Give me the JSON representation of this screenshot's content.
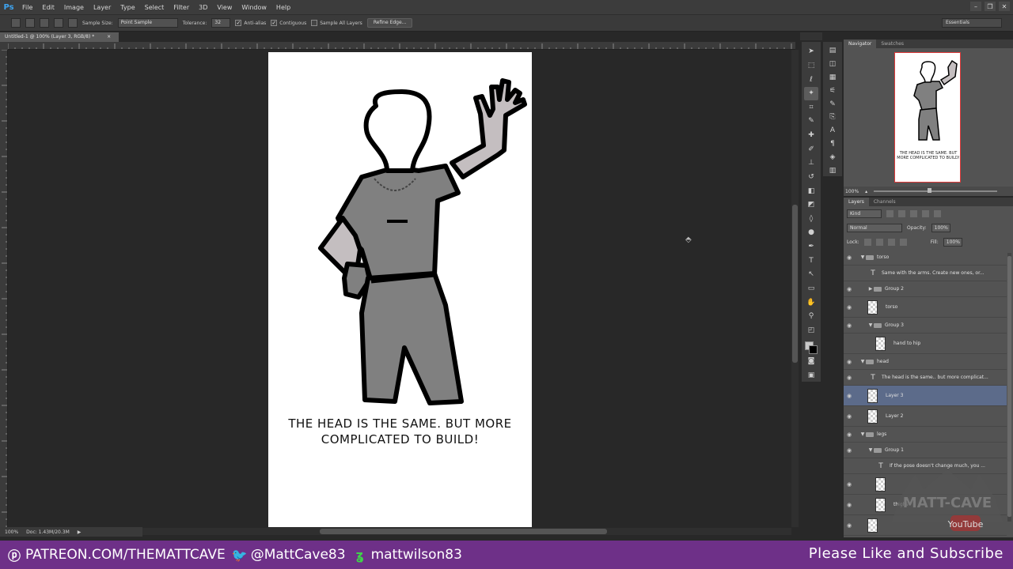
{
  "app": {
    "logo": "Ps",
    "menu": [
      "File",
      "Edit",
      "Image",
      "Layer",
      "Type",
      "Select",
      "Filter",
      "3D",
      "View",
      "Window",
      "Help"
    ],
    "window_controls": [
      "–",
      "❐",
      "✕"
    ]
  },
  "options_bar": {
    "sample_size_label": "Sample Size:",
    "sample_size_value": "Point Sample",
    "tolerance_label": "Tolerance:",
    "tolerance_value": "32",
    "antialias_label": "Anti-alias",
    "contiguous_label": "Contiguous",
    "sample_all_label": "Sample All Layers",
    "refine_edge_label": "Refine Edge...",
    "workspace": "Essentials"
  },
  "document": {
    "tab_title": "Untitled-1 @ 100% (Layer 3, RGB/8) *",
    "tab_close": "×",
    "caption": "THE HEAD IS THE SAME. BUT MORE COMPLICATED TO BUILD!"
  },
  "status_bar": {
    "zoom": "100%",
    "doc_info": "Doc: 1.43M/20.3M"
  },
  "navigator": {
    "tabs": [
      "Navigator",
      "Swatches"
    ],
    "caption": "THE HEAD IS THE SAME. BUT MORE COMPLICATED TO BUILD!",
    "zoom": "100%"
  },
  "layers_panel": {
    "tabs": [
      "Layers",
      "Channels"
    ],
    "filter_kind": "Kind",
    "blend_mode": "Normal",
    "opacity_label": "Opacity:",
    "opacity_value": "100%",
    "lock_label": "Lock:",
    "fill_label": "Fill:",
    "fill_value": "100%",
    "layers": [
      {
        "name": "torso",
        "type": "group-open",
        "indent": 0,
        "visible": true
      },
      {
        "name": "Same with the arms. Create new ones, or...",
        "type": "text",
        "indent": 1,
        "visible": false
      },
      {
        "name": "Group 2",
        "type": "group-closed",
        "indent": 1,
        "visible": true
      },
      {
        "name": "torso",
        "type": "pixel",
        "indent": 1,
        "visible": true
      },
      {
        "name": "Group 3",
        "type": "group-open",
        "indent": 1,
        "visible": true
      },
      {
        "name": "hand to hip",
        "type": "pixel",
        "indent": 2,
        "visible": false
      },
      {
        "name": "head",
        "type": "group-open",
        "indent": 0,
        "visible": true
      },
      {
        "name": "The head is the same.. but more complicat...",
        "type": "text",
        "indent": 1,
        "visible": true
      },
      {
        "name": "Layer 3",
        "type": "pixel",
        "indent": 1,
        "visible": true,
        "selected": true
      },
      {
        "name": "Layer 2",
        "type": "pixel",
        "indent": 1,
        "visible": true
      },
      {
        "name": "legs",
        "type": "group-open",
        "indent": 0,
        "visible": true
      },
      {
        "name": "Group 1",
        "type": "group-open",
        "indent": 1,
        "visible": true
      },
      {
        "name": "If the pose doesn't change much, you ...",
        "type": "text",
        "indent": 2,
        "visible": false
      },
      {
        "name": "",
        "type": "pixel",
        "indent": 2,
        "visible": true
      },
      {
        "name": "thighs",
        "type": "pixel",
        "indent": 2,
        "visible": true
      },
      {
        "name": "",
        "type": "pixel",
        "indent": 1,
        "visible": true
      }
    ]
  },
  "watermark": {
    "brand": "MATT-CAVE",
    "youtube": "YouTube"
  },
  "promo": {
    "patreon": "PATREON.COM/THEMATTCAVE",
    "twitter": "@MattCave83",
    "deviantart": "mattwilson83",
    "right": "Please Like and Subscribe"
  },
  "colors": {
    "promo_bar": "#6e3088",
    "selected_layer": "#5c6b8a",
    "figure_fill": "#808080",
    "arm_fill": "#c4bec0"
  }
}
